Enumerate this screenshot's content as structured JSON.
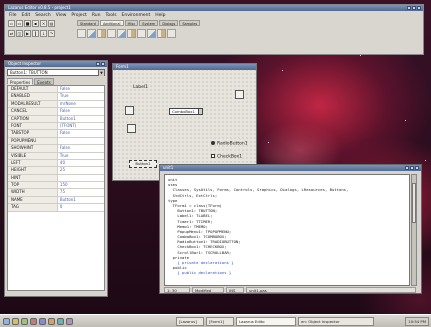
{
  "ide": {
    "title": "Lazarus Editor v0.8.5  -  project1",
    "menu": [
      "File",
      "Edit",
      "Search",
      "View",
      "Project",
      "Run",
      "Tools",
      "Environment",
      "Help"
    ],
    "palette_tabs": [
      "Standard",
      "Additional",
      "Misc",
      "System",
      "Dialogs",
      "Samples"
    ],
    "active_palette_tab": "Additional"
  },
  "inspector": {
    "title": "Object Inspector",
    "selected": "Button1: TBUTTON",
    "tabs": [
      "Properties",
      "Events"
    ],
    "properties": [
      {
        "name": "DEFAULT",
        "value": "False"
      },
      {
        "name": "ENABLED",
        "value": "True"
      },
      {
        "name": "MODALRESULT",
        "value": "mrNone"
      },
      {
        "name": "CANCEL",
        "value": "False"
      },
      {
        "name": "CAPTION",
        "value": "Button1"
      },
      {
        "name": "FONT",
        "value": "(TFONT)"
      },
      {
        "name": "TABSTOP",
        "value": "False"
      },
      {
        "name": "POPUPMENU",
        "value": ""
      },
      {
        "name": "SHOWHINT",
        "value": "False"
      },
      {
        "name": "VISIBLE",
        "value": "True"
      },
      {
        "name": "LEFT",
        "value": "40"
      },
      {
        "name": "HEIGHT",
        "value": "25"
      },
      {
        "name": "HINT",
        "value": ""
      },
      {
        "name": "TOP",
        "value": "150"
      },
      {
        "name": "WIDTH",
        "value": "75"
      },
      {
        "name": "NAME",
        "value": "Button1"
      },
      {
        "name": "TAG",
        "value": "0"
      }
    ]
  },
  "designer": {
    "title": "Form1",
    "label": "Label1",
    "combo": "ComboBox1",
    "radio": "RadioButton1",
    "check": "CheckBox1",
    "button": "Button1"
  },
  "editor": {
    "title": "unit1",
    "code": [
      {
        "text": "unit",
        "blue": false
      },
      {
        "text": "uses",
        "blue": false
      },
      {
        "text": "  Classes, SysUtils, Forms, Controls, Graphics, Dialogs, LResources, Buttons,",
        "blue": false
      },
      {
        "text": "  StdCtrls, ExtCtrls;",
        "blue": false
      },
      {
        "text": "type",
        "blue": false
      },
      {
        "text": "  TForm1 = class(TForm)",
        "blue": false
      },
      {
        "text": "    Button1: TBUTTON;",
        "blue": false
      },
      {
        "text": "    Label1: TLABEL;",
        "blue": false
      },
      {
        "text": "    Timer1: TTIMER;",
        "blue": false
      },
      {
        "text": "    Memo1: TMEMO;",
        "blue": false
      },
      {
        "text": "    PopupMenu1: TPOPUPMENU;",
        "blue": false
      },
      {
        "text": "    ComboBox1: TCOMBOBOX;",
        "blue": false
      },
      {
        "text": "    RadioButton1: TRADIOBUTTON;",
        "blue": false
      },
      {
        "text": "    CheckBox1: TCHECKBOX;",
        "blue": false
      },
      {
        "text": "    ScrollBar1: TSCROLLBAR;",
        "blue": false
      },
      {
        "text": "  private",
        "blue": false
      },
      {
        "text": "    { private declarations }",
        "blue": true
      },
      {
        "text": "  public",
        "blue": false
      },
      {
        "text": "    { public declarations }",
        "blue": true
      }
    ],
    "status": {
      "position": "1: 30",
      "mode": "Modified",
      "insert": "INS",
      "file": "unit1.pas"
    }
  },
  "taskbar": {
    "tasks": [
      "[Lazarus]",
      "[Form1]",
      "Lazarus Edito",
      "en: Object Inspector"
    ],
    "clock": "10:54 PM"
  },
  "colors": {
    "titlebar": "#506a94",
    "desktop": "#2a0d1e",
    "accent": "#c82846"
  }
}
